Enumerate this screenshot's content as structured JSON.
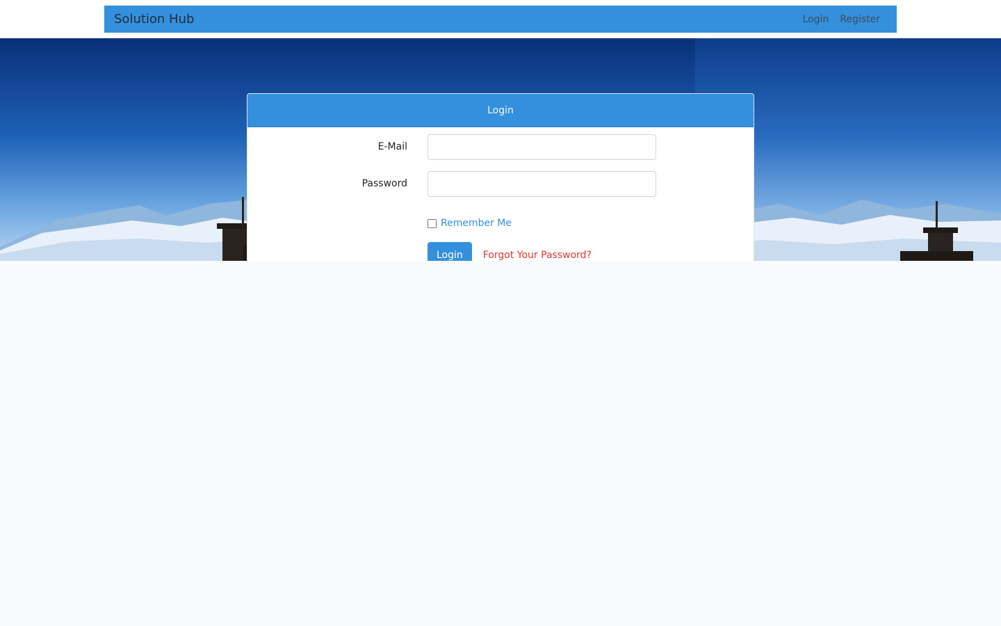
{
  "navbar": {
    "brand": "Solution Hub",
    "links": [
      {
        "label": "Login"
      },
      {
        "label": "Register"
      }
    ]
  },
  "login_card": {
    "title": "Login",
    "email_label": "E-Mail",
    "email_value": "",
    "password_label": "Password",
    "password_value": "",
    "remember_label": "Remember Me",
    "remember_checked": false,
    "submit_label": "Login",
    "forgot_label": "Forgot Your Password?"
  },
  "colors": {
    "primary": "#3490dc",
    "danger": "#e3342f",
    "page_bg": "#f8fafc"
  }
}
